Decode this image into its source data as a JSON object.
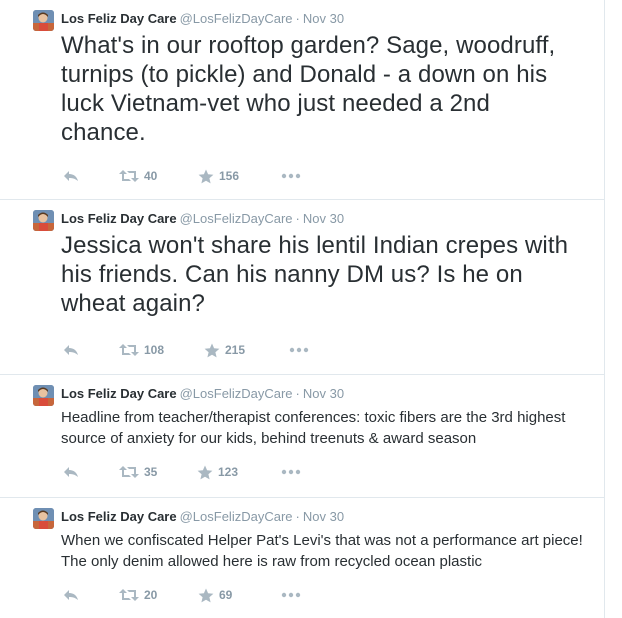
{
  "tweets": [
    {
      "fullname": "Los Feliz Day Care",
      "username": "@LosFelizDayCare",
      "separator": "·",
      "time": "Nov 30",
      "text": "What's in our rooftop garden? Sage, woodruff, turnips (to pickle) and Donald - a down on his luck Vietnam-vet who just needed a 2nd chance.",
      "retweets": "40",
      "favorites": "156"
    },
    {
      "fullname": "Los Feliz Day Care",
      "username": "@LosFelizDayCare",
      "separator": "·",
      "time": "Nov 30",
      "text": "Jessica won't share his lentil Indian crepes with his friends. Can his nanny DM us? Is he on wheat again?",
      "retweets": "108",
      "favorites": "215"
    },
    {
      "fullname": "Los Feliz Day Care",
      "username": "@LosFelizDayCare",
      "separator": "·",
      "time": "Nov 30",
      "text": "Headline from teacher/therapist conferences: toxic fibers are the 3rd highest source of anxiety for our kids, behind treenuts & award season",
      "retweets": "35",
      "favorites": "123"
    },
    {
      "fullname": "Los Feliz Day Care",
      "username": "@LosFelizDayCare",
      "separator": "·",
      "time": "Nov 30",
      "text": "When we confiscated Helper Pat's Levi's that was not a performance art piece! The only denim allowed here is raw from recycled ocean plastic",
      "retweets": "20",
      "favorites": "69"
    }
  ],
  "icons": {
    "reply": "reply-icon",
    "retweet": "retweet-icon",
    "favorite": "star-icon",
    "more": "more-icon"
  },
  "colors": {
    "text": "#292f33",
    "secondary": "#8899a6",
    "icon": "#aab8c2",
    "divider": "#e1e8ed"
  }
}
